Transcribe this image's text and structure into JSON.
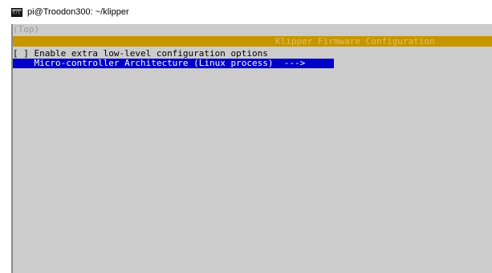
{
  "window": {
    "title": "pi@Troodon300: ~/klipper",
    "icon": "console-icon"
  },
  "terminal": {
    "breadcrumb": "(Top)",
    "menu_title": "Klipper Firmware Configuration",
    "options": [
      {
        "checkbox": "[ ]",
        "label": "Enable extra low-level configuration options"
      },
      {
        "label": "Micro-controller Architecture (Linux process)",
        "arrow": "--->"
      }
    ],
    "colors": {
      "background": "#cccccc",
      "title_bar": "#c69500",
      "selection": "#0000c8"
    }
  }
}
